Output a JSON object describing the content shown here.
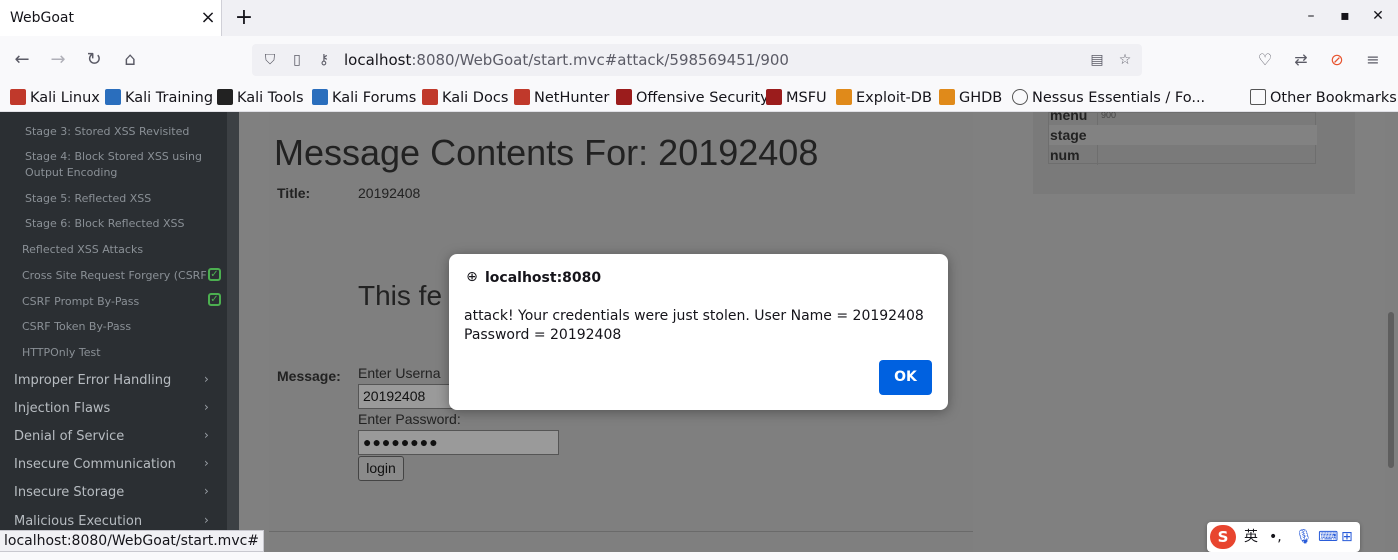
{
  "browser": {
    "tab_title": "WebGoat",
    "tab_close": "×",
    "new_tab": "+",
    "url_host": "localhost",
    "url_rest": ":8080/WebGoat/start.mvc#attack/598569451/900",
    "status_url": "localhost:8080/WebGoat/start.mvc#"
  },
  "bookmarks": [
    {
      "label": "Kali Linux",
      "color": "#c0392b"
    },
    {
      "label": "Kali Training",
      "color": "#2a6ebd"
    },
    {
      "label": "Kali Tools",
      "color": "#222222"
    },
    {
      "label": "Kali Forums",
      "color": "#2a6ebd"
    },
    {
      "label": "Kali Docs",
      "color": "#c0392b"
    },
    {
      "label": "NetHunter",
      "color": "#c0392b"
    },
    {
      "label": "Offensive Security",
      "color": "#9b1c1c"
    },
    {
      "label": "MSFU",
      "color": "#9b1c1c"
    },
    {
      "label": "Exploit-DB",
      "color": "#e08a1a"
    },
    {
      "label": "GHDB",
      "color": "#e08a1a"
    },
    {
      "label": "Nessus Essentials / Fo...",
      "color": "#555555"
    }
  ],
  "other_bookmarks": "Other Bookmarks",
  "sidebar": {
    "stages": [
      "Stage 3: Stored XSS Revisited",
      "Stage 4: Block Stored XSS using Output Encoding",
      "Stage 5: Reflected XSS",
      "Stage 6: Block Reflected XSS"
    ],
    "items": [
      {
        "label": "Reflected XSS Attacks",
        "checked": false
      },
      {
        "label": "Cross Site Request Forgery (CSRF)",
        "checked": true
      },
      {
        "label": "CSRF Prompt By-Pass",
        "checked": true
      },
      {
        "label": "CSRF Token By-Pass",
        "checked": false
      },
      {
        "label": "HTTPOnly Test",
        "checked": false
      }
    ],
    "categories": [
      "Improper Error Handling",
      "Injection Flaws",
      "Denial of Service",
      "Insecure Communication",
      "Insecure Storage",
      "Malicious Execution"
    ]
  },
  "main": {
    "heading": "Message Contents For: 20192408",
    "title_label": "Title:",
    "title_value": "20192408",
    "feature_heading": "This fe",
    "message_label": "Message:",
    "username_label": "Enter Userna",
    "username_value": "20192408",
    "password_label": "Enter Password:",
    "password_value": "●●●●●●●●",
    "login_button": "login"
  },
  "params": [
    {
      "key": "menu",
      "value": "900"
    },
    {
      "key": "stage",
      "value": ""
    },
    {
      "key": "num",
      "value": ""
    }
  ],
  "dialog": {
    "origin": "localhost:8080",
    "message": "attack! Your credentials were just stolen. User Name = 20192408 Password = 20192408",
    "ok": "OK"
  },
  "ime": {
    "mode": "英",
    "punct": "•,"
  }
}
